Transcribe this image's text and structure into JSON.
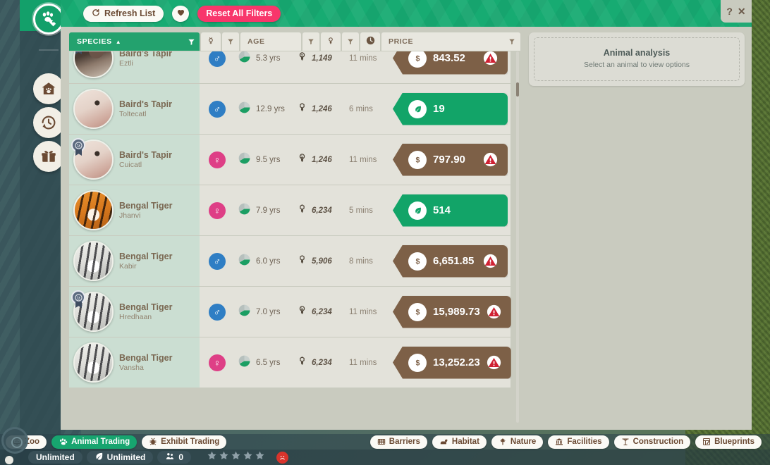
{
  "window": {
    "help_label": "?",
    "close_label": "✕"
  },
  "rail": {
    "items": [
      {
        "name": "animal-trading",
        "icon": "paw-tag-icon",
        "active": true
      },
      {
        "name": "habitat-animals",
        "icon": "home-paw-icon",
        "active": false
      },
      {
        "name": "trade-history",
        "icon": "history-clock-icon",
        "active": false
      },
      {
        "name": "gifts",
        "icon": "gift-icon",
        "active": false
      }
    ]
  },
  "toolbar": {
    "refresh_label": "Refresh List",
    "refresh_icon": "refresh-icon",
    "favorite_icon": "heart-icon",
    "reset_label": "Reset All Filters"
  },
  "columns": {
    "species": {
      "label": "SPECIES",
      "sort": "▲",
      "filter_icon": "funnel-icon"
    },
    "gender": {
      "icon": "gender-icon",
      "filter_icon": "funnel-icon"
    },
    "age": {
      "label": "AGE",
      "filter_icon": "funnel-icon"
    },
    "award": {
      "icon": "medal-icon",
      "filter_icon": "funnel-icon"
    },
    "time": {
      "icon": "clock-icon"
    },
    "price": {
      "label": "PRICE",
      "filter_icon": "funnel-icon"
    }
  },
  "rows": [
    {
      "species": "Baird's Tapir",
      "nickname": "Eztli",
      "gender": "male",
      "gender_glyph": "♂",
      "age": "5.3 yrs",
      "award": "1,149",
      "award_icon": "medal-graded-icon",
      "time": "11 mins",
      "price_type": "money",
      "price_icon": "dollar-icon",
      "price": "843.52",
      "warning": true,
      "badge": true,
      "coat": "tapir-dark"
    },
    {
      "species": "Baird's Tapir",
      "nickname": "Toltecatl",
      "gender": "male",
      "gender_glyph": "♂",
      "age": "12.9 yrs",
      "award": "1,246",
      "award_icon": "medal-plain-icon",
      "time": "6 mins",
      "price_type": "credits",
      "price_icon": "leaf-icon",
      "price": "19",
      "warning": false,
      "badge": false,
      "coat": "tapir-light"
    },
    {
      "species": "Baird's Tapir",
      "nickname": "Cuicatl",
      "gender": "female",
      "gender_glyph": "♀",
      "age": "9.5 yrs",
      "award": "1,246",
      "award_icon": "medal-graded-icon",
      "time": "11 mins",
      "price_type": "money",
      "price_icon": "dollar-icon",
      "price": "797.90",
      "warning": true,
      "badge": true,
      "coat": "tapir-light"
    },
    {
      "species": "Bengal Tiger",
      "nickname": "Jhanvi",
      "gender": "female",
      "gender_glyph": "♀",
      "age": "7.9 yrs",
      "award": "6,234",
      "award_icon": "medal-plain-icon",
      "time": "5 mins",
      "price_type": "credits",
      "price_icon": "leaf-icon",
      "price": "514",
      "warning": false,
      "badge": false,
      "coat": "tiger-orange"
    },
    {
      "species": "Bengal Tiger",
      "nickname": "Kabir",
      "gender": "male",
      "gender_glyph": "♂",
      "age": "6.0 yrs",
      "award": "5,906",
      "award_icon": "medal-plain-icon",
      "time": "8 mins",
      "price_type": "money",
      "price_icon": "dollar-icon",
      "price": "6,651.85",
      "warning": true,
      "badge": false,
      "coat": "tiger-white"
    },
    {
      "species": "Bengal Tiger",
      "nickname": "Hredhaan",
      "gender": "male",
      "gender_glyph": "♂",
      "age": "7.0 yrs",
      "award": "6,234",
      "award_icon": "medal-graded-icon",
      "time": "11 mins",
      "price_type": "money",
      "price_icon": "dollar-icon",
      "price": "15,989.73",
      "warning": true,
      "badge": true,
      "coat": "tiger-white"
    },
    {
      "species": "Bengal Tiger",
      "nickname": "Vansha",
      "gender": "female",
      "gender_glyph": "♀",
      "age": "6.5 yrs",
      "award": "6,234",
      "award_icon": "medal-plain-icon",
      "time": "11 mins",
      "price_type": "money",
      "price_icon": "dollar-icon",
      "price": "13,252.23",
      "warning": true,
      "badge": false,
      "coat": "tiger-white"
    }
  ],
  "analysis": {
    "title": "Animal analysis",
    "subtitle": "Select an animal to view options"
  },
  "bottom_nav": {
    "left": [
      {
        "label": "Zoo",
        "icon": "zoo-board-icon",
        "active": false
      },
      {
        "label": "Animal Trading",
        "icon": "paw-icon",
        "active": true
      },
      {
        "label": "Exhibit Trading",
        "icon": "bug-icon",
        "active": false
      }
    ],
    "right": [
      {
        "label": "Barriers",
        "icon": "fence-icon"
      },
      {
        "label": "Habitat",
        "icon": "habitat-icon"
      },
      {
        "label": "Nature",
        "icon": "tree-icon"
      },
      {
        "label": "Facilities",
        "icon": "building-icon"
      },
      {
        "label": "Construction",
        "icon": "crane-icon"
      },
      {
        "label": "Blueprints",
        "icon": "blueprint-icon"
      }
    ]
  },
  "status": {
    "money": "Unlimited",
    "credits": "Unlimited",
    "credits_icon": "leaf-icon",
    "guests": "0",
    "guests_icon": "guests-icon",
    "stars": 5,
    "mood_icon": "sad-face-icon"
  },
  "colors": {
    "brand_green": "#17ab72",
    "accent_pink": "#f8366b",
    "money_brown": "#7d6047",
    "credits_green": "#12a468",
    "male_blue": "#2f7ec4",
    "female_pink": "#de3f86",
    "warning_red": "#cf2233"
  }
}
